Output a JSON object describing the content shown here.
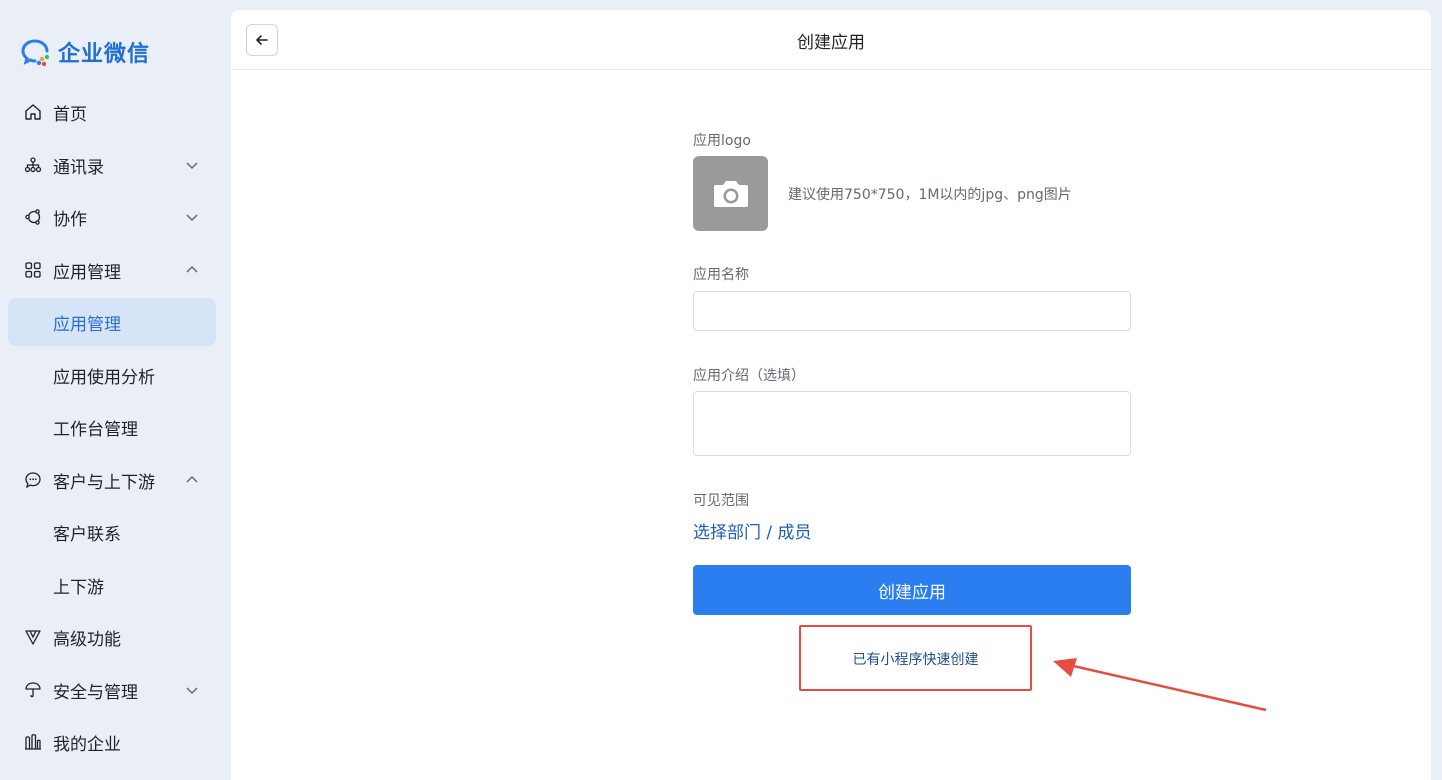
{
  "brand": {
    "name": "企业微信"
  },
  "sidebar": {
    "items": [
      {
        "label": "首页"
      },
      {
        "label": "通讯录"
      },
      {
        "label": "协作"
      },
      {
        "label": "应用管理"
      },
      {
        "label": "应用管理"
      },
      {
        "label": "应用使用分析"
      },
      {
        "label": "工作台管理"
      },
      {
        "label": "客户与上下游"
      },
      {
        "label": "客户联系"
      },
      {
        "label": "上下游"
      },
      {
        "label": "高级功能"
      },
      {
        "label": "安全与管理"
      },
      {
        "label": "我的企业"
      }
    ]
  },
  "header": {
    "title": "创建应用"
  },
  "form": {
    "logo_label": "应用logo",
    "logo_hint": "建议使用750*750，1M以内的jpg、png图片",
    "name_label": "应用名称",
    "name_value": "",
    "intro_label": "应用介绍（选填）",
    "intro_value": "",
    "scope_label": "可见范围",
    "scope_link": "选择部门 / 成员",
    "submit_label": "创建应用",
    "quick_create_link": "已有小程序快速创建"
  },
  "colors": {
    "accent": "#2a7ef0",
    "link": "#1d5fb8",
    "annotation": "#e54d42",
    "active_bg": "#d6e4f8"
  }
}
